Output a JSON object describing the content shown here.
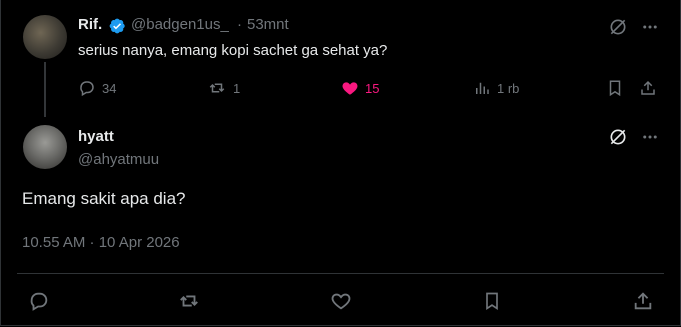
{
  "reply_to": {
    "display_name": "Rif.",
    "handle": "@badgen1us_",
    "separator": "·",
    "time": "53mnt",
    "text": "serius nanya, emang kopi sachet ga sehat ya?",
    "stats": {
      "replies": "34",
      "reposts": "1",
      "likes": "15",
      "views": "1 rb"
    },
    "liked": true
  },
  "main_post": {
    "display_name": "hyatt",
    "handle": "@ahyatmuu",
    "text": "Emang sakit apa dia?",
    "timestamp": "10.55 AM · 10 Apr 2026"
  },
  "colors": {
    "background": "#000000",
    "text": "#e7e9ea",
    "secondary": "#71767b",
    "like": "#f91880",
    "verified": "#1d9bf0",
    "divider": "#2f3336"
  }
}
